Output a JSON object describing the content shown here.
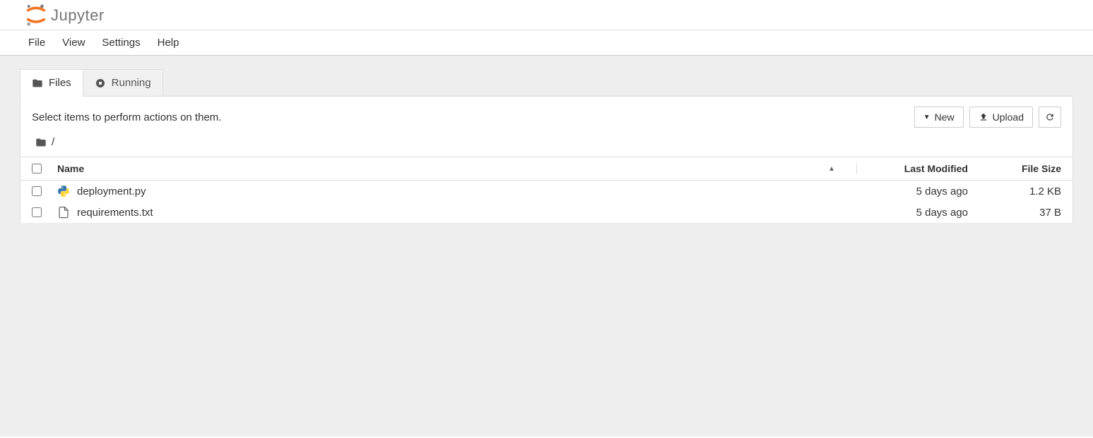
{
  "header": {
    "logo_text": "Jupyter"
  },
  "menubar": {
    "items": [
      "File",
      "View",
      "Settings",
      "Help"
    ]
  },
  "tabs": [
    {
      "label": "Files",
      "icon": "folder-icon",
      "active": true
    },
    {
      "label": "Running",
      "icon": "running-icon",
      "active": false
    }
  ],
  "toolbar": {
    "hint": "Select items to perform actions on them.",
    "new_label": "New",
    "upload_label": "Upload"
  },
  "breadcrumb": {
    "root": "/"
  },
  "columns": {
    "name": "Name",
    "last_modified": "Last Modified",
    "file_size": "File Size"
  },
  "files": [
    {
      "name": "deployment.py",
      "type": "python",
      "modified": "5 days ago",
      "size": "1.2 KB"
    },
    {
      "name": "requirements.txt",
      "type": "text",
      "modified": "5 days ago",
      "size": "37 B"
    }
  ]
}
